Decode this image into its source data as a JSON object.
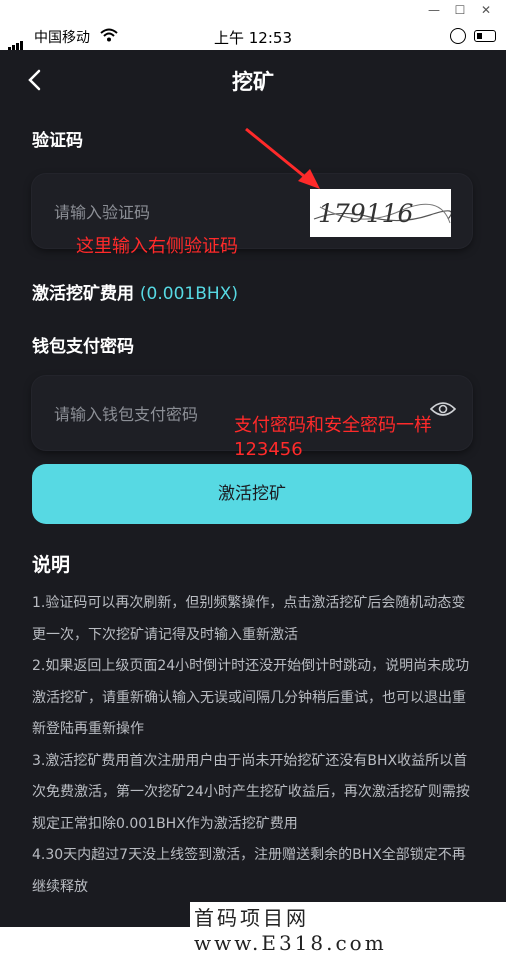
{
  "status_bar": {
    "carrier": "中国移动",
    "time": "上午 12:53"
  },
  "header": {
    "title": "挖矿"
  },
  "captcha_section": {
    "label": "验证码",
    "placeholder": "请输入验证码",
    "captcha_text": "179116"
  },
  "fee_section": {
    "label": "激活挖矿费用",
    "value": "(0.001BHX)"
  },
  "password_section": {
    "label": "钱包支付密码",
    "placeholder": "请输入钱包支付密码"
  },
  "activate_button": {
    "label": "激活挖矿"
  },
  "description": {
    "heading": "说明",
    "items": [
      "1.验证码可以再次刷新，但别频繁操作，点击激活挖矿后会随机动态变更一次，下次挖矿请记得及时输入重新激活",
      "2.如果返回上级页面24小时倒计时还没开始倒计时跳动，说明尚未成功激活挖矿，请重新确认输入无误或间隔几分钟稍后重试，也可以退出重新登陆再重新操作",
      "3.激活挖矿费用首次注册用户由于尚未开始挖矿还没有BHX收益所以首次免费激活，第一次挖矿24小时产生挖矿收益后，再次激活挖矿则需按规定正常扣除0.001BHX作为激活挖矿费用",
      "4.30天内超过7天没上线签到激活，注册赠送剩余的BHX全部锁定不再继续释放"
    ]
  },
  "annotations": {
    "captcha_note": "这里输入右侧验证码",
    "password_note_line1": "支付密码和安全密码一样",
    "password_note_line2": "123456"
  },
  "watermark": "首码项目网 www.E318.com",
  "colors": {
    "background": "#1a1b20",
    "accent": "#57d9e3",
    "annotation": "#ff2a2a"
  }
}
